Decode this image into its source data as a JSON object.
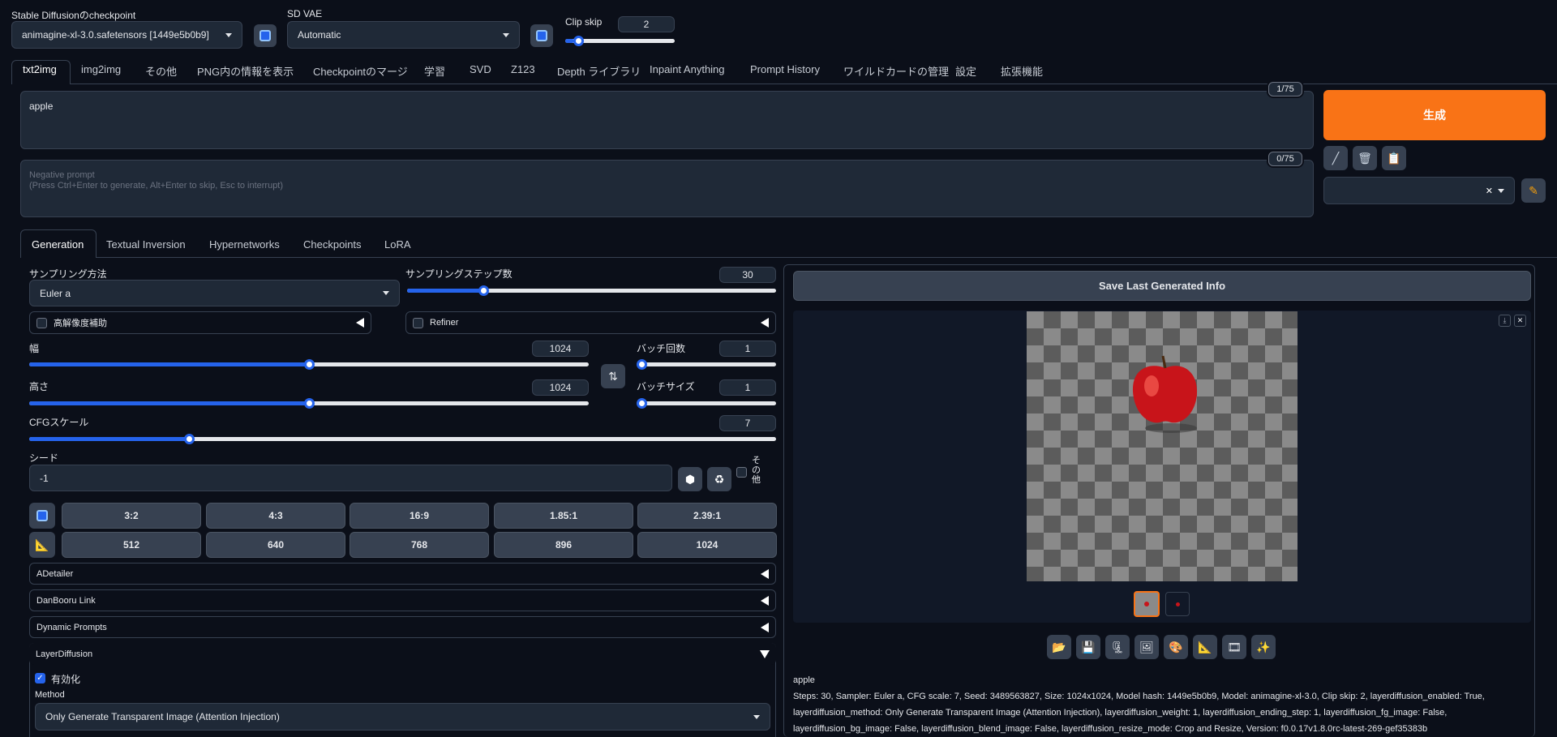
{
  "header": {
    "checkpoint_label": "Stable Diffusionのcheckpoint",
    "checkpoint_value": "animagine-xl-3.0.safetensors [1449e5b0b9]",
    "vae_label": "SD VAE",
    "vae_value": "Automatic",
    "clip_skip_label": "Clip skip",
    "clip_skip_value": "2",
    "clip_skip_level": 0.08
  },
  "tabs": [
    "txt2img",
    "img2img",
    "その他",
    "PNG内の情報を表示",
    "Checkpointのマージ",
    "学習",
    "SVD",
    "Z123",
    "Depth ライブラリ",
    "Inpaint Anything",
    "Prompt History",
    "ワイルドカードの管理",
    "設定",
    "拡張機能"
  ],
  "prompt": {
    "value": "apple",
    "token_count": "1/75",
    "negative_placeholder_1": "Negative prompt",
    "negative_placeholder_2": "(Press Ctrl+Enter to generate, Alt+Enter to skip, Esc to interrupt)",
    "negative_token_count": "0/75"
  },
  "generate_button": "生成",
  "subtabs": [
    "Generation",
    "Textual Inversion",
    "Hypernetworks",
    "Checkpoints",
    "LoRA"
  ],
  "settings": {
    "sampler_label": "サンプリング方法",
    "sampler_value": "Euler a",
    "steps_label": "サンプリングステップ数",
    "steps_value": "30",
    "steps_level": 0.2,
    "hires_label": "高解像度補助",
    "refiner_label": "Refiner",
    "width_label": "幅",
    "width_value": "1024",
    "width_level": 0.5,
    "height_label": "高さ",
    "height_value": "1024",
    "height_level": 0.5,
    "batch_count_label": "バッチ回数",
    "batch_count_value": "1",
    "batch_count_level": 0.0,
    "batch_size_label": "バッチサイズ",
    "batch_size_value": "1",
    "batch_size_level": 0.0,
    "cfg_label": "CFGスケール",
    "cfg_value": "7",
    "cfg_level": 0.21,
    "seed_label": "シード",
    "seed_value": "-1",
    "extra_label": "その他"
  },
  "ratio_buttons": [
    "3:2",
    "4:3",
    "16:9",
    "1.85:1",
    "2.39:1"
  ],
  "size_buttons": [
    "512",
    "640",
    "768",
    "896",
    "1024"
  ],
  "accordions": {
    "adetailer": "ADetailer",
    "danbooru": "DanBooru Link",
    "dynamic": "Dynamic Prompts",
    "layer": "LayerDiffusion"
  },
  "layer": {
    "enable_label": "有効化",
    "method_label": "Method",
    "method_value": "Only Generate Transparent Image (Attention Injection)"
  },
  "output": {
    "save_button": "Save Last Generated Info",
    "prompt": "apple",
    "info_line1": "Steps: 30, Sampler: Euler a, CFG scale: 7, Seed: 3489563827, Size: 1024x1024, Model hash: 1449e5b0b9, Model: animagine-xl-3.0, Clip skip: 2, layerdiffusion_enabled: True,",
    "info_line2": "layerdiffusion_method: Only Generate Transparent Image (Attention Injection), layerdiffusion_weight: 1, layerdiffusion_ending_step: 1, layerdiffusion_fg_image: False,",
    "info_line3": "layerdiffusion_bg_image: False, layerdiffusion_blend_image: False, layerdiffusion_resize_mode: Crop and Resize, Version: f0.0.17v1.8.0rc-latest-269-gef35383b"
  },
  "icons": {
    "tools": [
      "folder-icon",
      "save-icon",
      "zip-icon",
      "image-icon",
      "palette-icon",
      "ruler-icon",
      "film-icon",
      "sparkle-icon"
    ]
  },
  "colors": {
    "accent": "#2563eb",
    "generate": "#f97316",
    "background": "#0b0f19"
  }
}
